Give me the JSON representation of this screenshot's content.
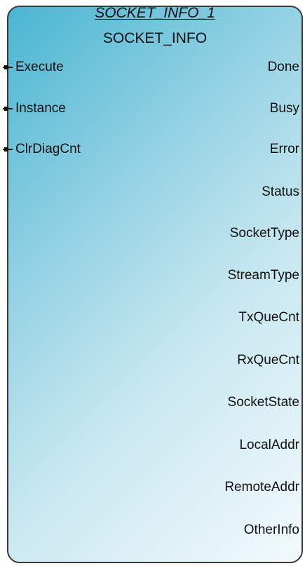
{
  "block": {
    "instance_name": "SOCKET_INFO_1",
    "type_name": "SOCKET_INFO"
  },
  "inputs": [
    {
      "label": "Execute"
    },
    {
      "label": "Instance"
    },
    {
      "label": "ClrDiagCnt"
    }
  ],
  "outputs": [
    {
      "label": "Done"
    },
    {
      "label": "Busy"
    },
    {
      "label": "Error"
    },
    {
      "label": "Status"
    },
    {
      "label": "SocketType"
    },
    {
      "label": "StreamType"
    },
    {
      "label": "TxQueCnt"
    },
    {
      "label": "RxQueCnt"
    },
    {
      "label": "SocketState"
    },
    {
      "label": "LocalAddr"
    },
    {
      "label": "RemoteAddr"
    },
    {
      "label": "OtherInfo"
    }
  ],
  "colors": {
    "gradient_start": "#4ab6d2",
    "gradient_end": "#f3fafc",
    "border": "#3a3a3a"
  }
}
